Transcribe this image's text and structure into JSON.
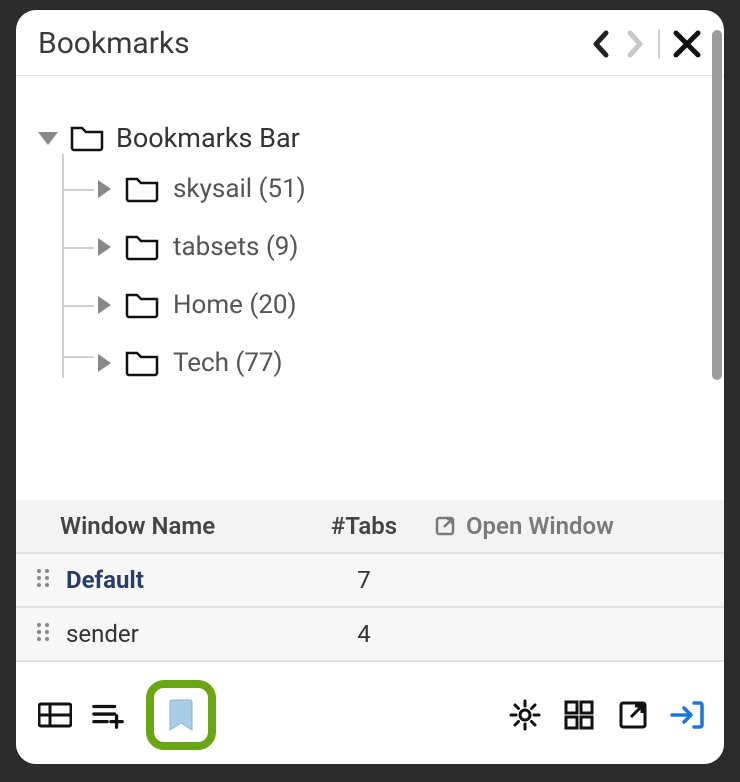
{
  "header": {
    "title": "Bookmarks"
  },
  "tree": {
    "root_label": "Bookmarks Bar",
    "items": [
      {
        "label": "skysail (51)"
      },
      {
        "label": "tabsets (9)"
      },
      {
        "label": "Home (20)"
      },
      {
        "label": "Tech (77)"
      }
    ]
  },
  "table": {
    "col_name": "Window Name",
    "col_tabs": "#Tabs",
    "open_window": "Open Window",
    "rows": [
      {
        "name": "Default",
        "tabs": "7"
      },
      {
        "name": "sender",
        "tabs": "4"
      }
    ]
  }
}
